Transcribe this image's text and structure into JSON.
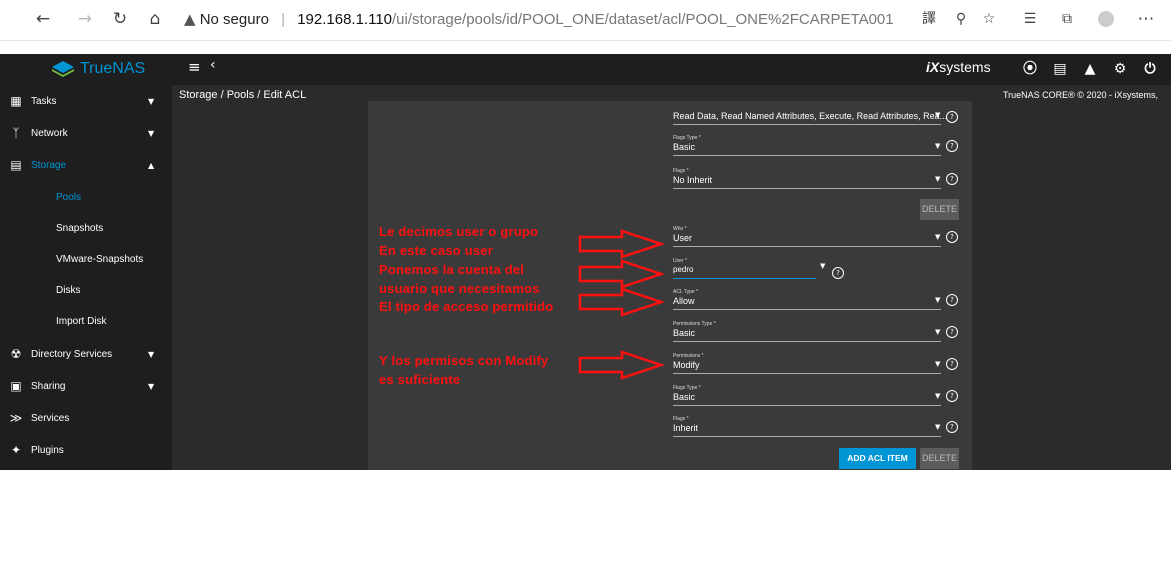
{
  "browser": {
    "warning_icon": "warning-triangle",
    "security_text": "No seguro",
    "url_host": "192.168.1.110",
    "url_path": "/ui/storage/pools/id/POOL_ONE/dataset/acl/POOL_ONE%2FCARPETA001"
  },
  "app": {
    "brand": "TrueNAS",
    "edition": "CORE",
    "vendor_logo": "iXsystems",
    "breadcrumb": "Storage / Pools / Edit ACL",
    "copyright": "TrueNAS CORE® © 2020 - iXsystems, "
  },
  "sidebar": {
    "items": [
      {
        "label": "Tasks",
        "icon": "calendar-icon"
      },
      {
        "label": "Network",
        "icon": "network-icon"
      },
      {
        "label": "Storage",
        "icon": "storage-icon"
      },
      {
        "label": "Directory Services",
        "icon": "directory-icon"
      },
      {
        "label": "Sharing",
        "icon": "sharing-icon"
      },
      {
        "label": "Services",
        "icon": "services-icon"
      },
      {
        "label": "Plugins",
        "icon": "plugins-icon"
      }
    ],
    "storage_sub": [
      "Pools",
      "Snapshots",
      "VMware-Snapshots",
      "Disks",
      "Import Disk"
    ]
  },
  "form": {
    "perm_top": "Read Data, Read Named Attributes, Execute, Read Attributes, Rea...",
    "flags_type1_label": "Flags Type *",
    "flags_type1_value": "Basic",
    "flags1_label": "Flags *",
    "flags1_value": "No Inherit",
    "delete_label": "DELETE",
    "who_label": "Who *",
    "who_value": "User",
    "user_label": "User *",
    "user_value": "pedro",
    "acl_type_label": "ACL Type *",
    "acl_type_value": "Allow",
    "perm_type_label": "Permissions Type *",
    "perm_type_value": "Basic",
    "perm_label": "Permissions *",
    "perm_value": "Modify",
    "flags_type2_label": "Flags Type *",
    "flags_type2_value": "Basic",
    "flags2_label": "Flags *",
    "flags2_value": "Inherit",
    "add_acl_label": "ADD ACL ITEM",
    "delete2_label": "DELETE"
  },
  "annotations": {
    "line1": "Le decimos user o grupo",
    "line2": "En este caso user",
    "line3": "Ponemos la cuenta del",
    "line4": "usuario que necesitamos",
    "line5": "El tipo de acceso permitido",
    "line6": "Y los permisos con Modify",
    "line7": "es suficiente",
    "color": "#ff1010"
  },
  "colors": {
    "accent": "#0095d5",
    "topbar": "#1e1e1e",
    "panel": "#2b2b2b",
    "card": "#3a3a3a"
  }
}
